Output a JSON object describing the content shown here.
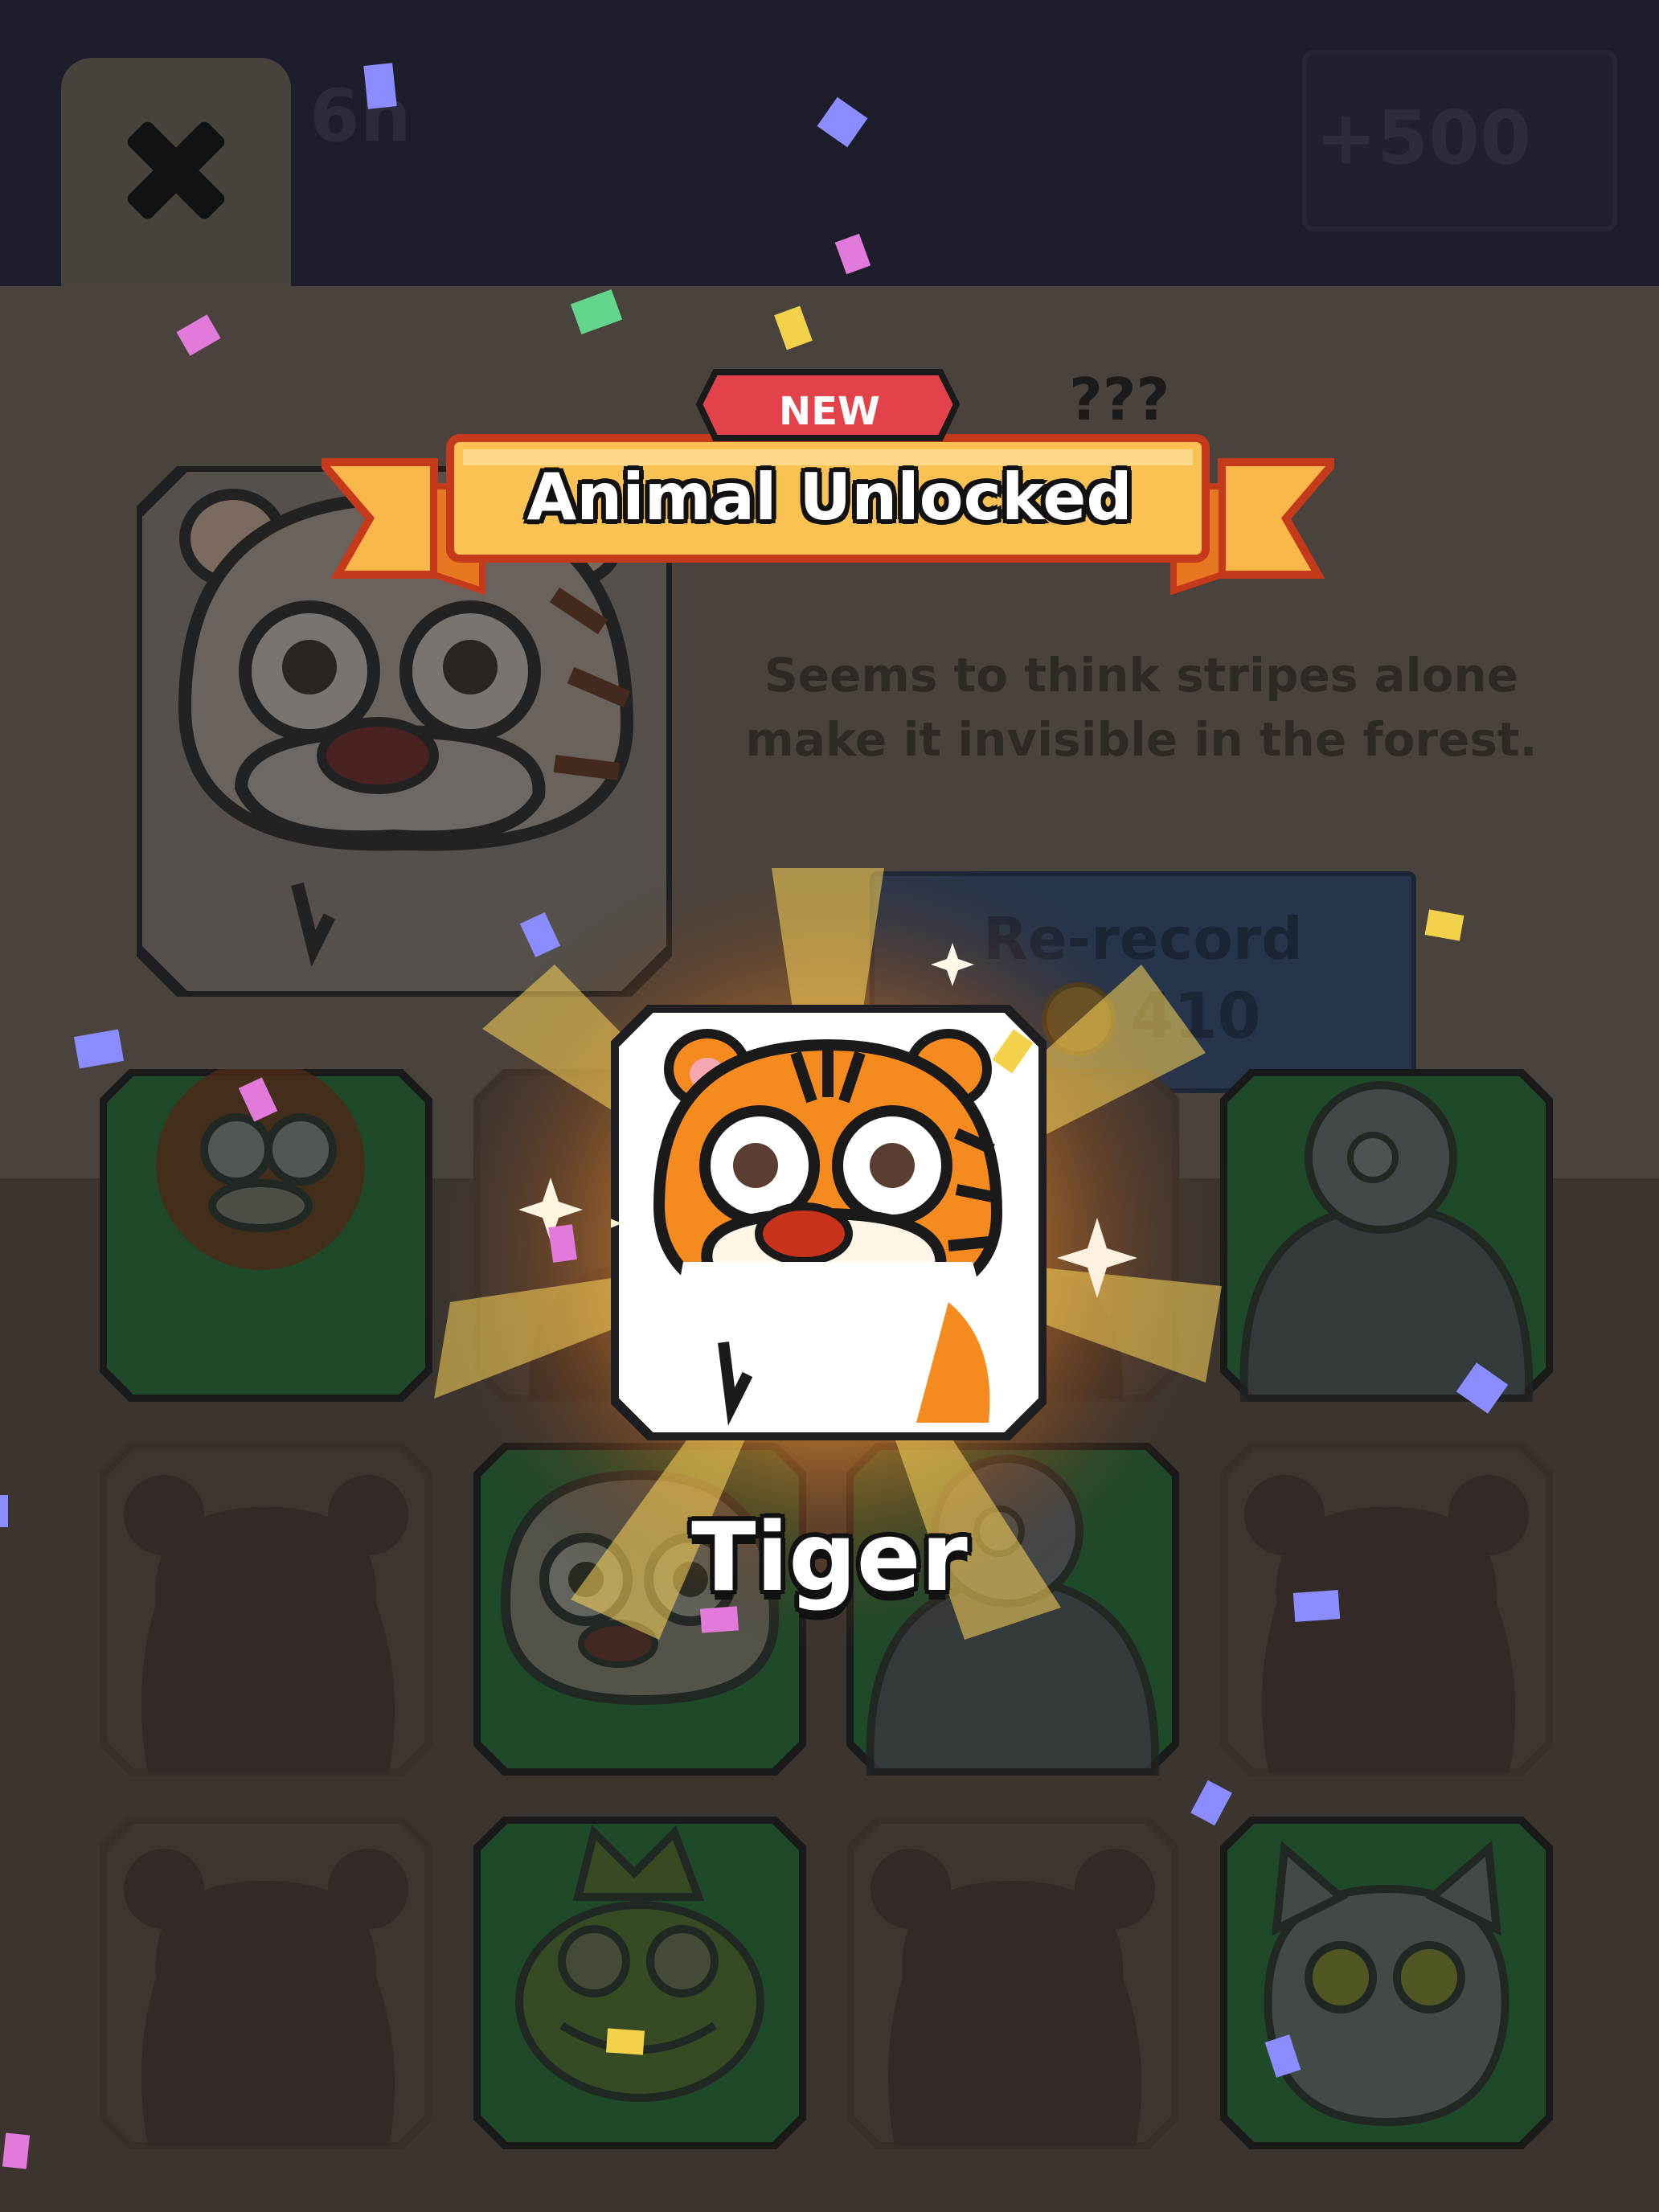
{
  "hud": {
    "left_value": "6h",
    "coins_value": "+500"
  },
  "panel": {
    "mystery_label": "???",
    "description": "Seems to think stripes alone make it invisible in the forest.",
    "rerecord_label": "Re-record",
    "rerecord_cost": "410"
  },
  "unlock": {
    "badge": "NEW",
    "title": "Animal Unlocked",
    "animal_name": "Tiger"
  },
  "grid": [
    {
      "animal": "lion",
      "state": "unlocked"
    },
    {
      "animal": "empty",
      "state": "locked"
    },
    {
      "animal": "empty",
      "state": "locked"
    },
    {
      "animal": "gorilla",
      "state": "unlocked"
    },
    {
      "animal": "bear",
      "state": "locked"
    },
    {
      "animal": "tiger",
      "state": "unlocked"
    },
    {
      "animal": "gorilla",
      "state": "unlocked"
    },
    {
      "animal": "bear",
      "state": "locked"
    },
    {
      "animal": "bear",
      "state": "locked"
    },
    {
      "animal": "frog-king",
      "state": "unlocked"
    },
    {
      "animal": "bear",
      "state": "locked"
    },
    {
      "animal": "cat",
      "state": "unlocked"
    }
  ],
  "colors": {
    "background": "#3b342f",
    "banner": "#f9b64a",
    "badge": "#e4424a",
    "tiger_orange": "#f58a1f",
    "card_green": "#1f4a2a",
    "confetti": [
      "#8a8cff",
      "#e27adb",
      "#f2d24a",
      "#62d68a"
    ]
  },
  "icons": [
    "close-icon",
    "coin-icon",
    "sparkle-icon",
    "tiger-icon"
  ]
}
